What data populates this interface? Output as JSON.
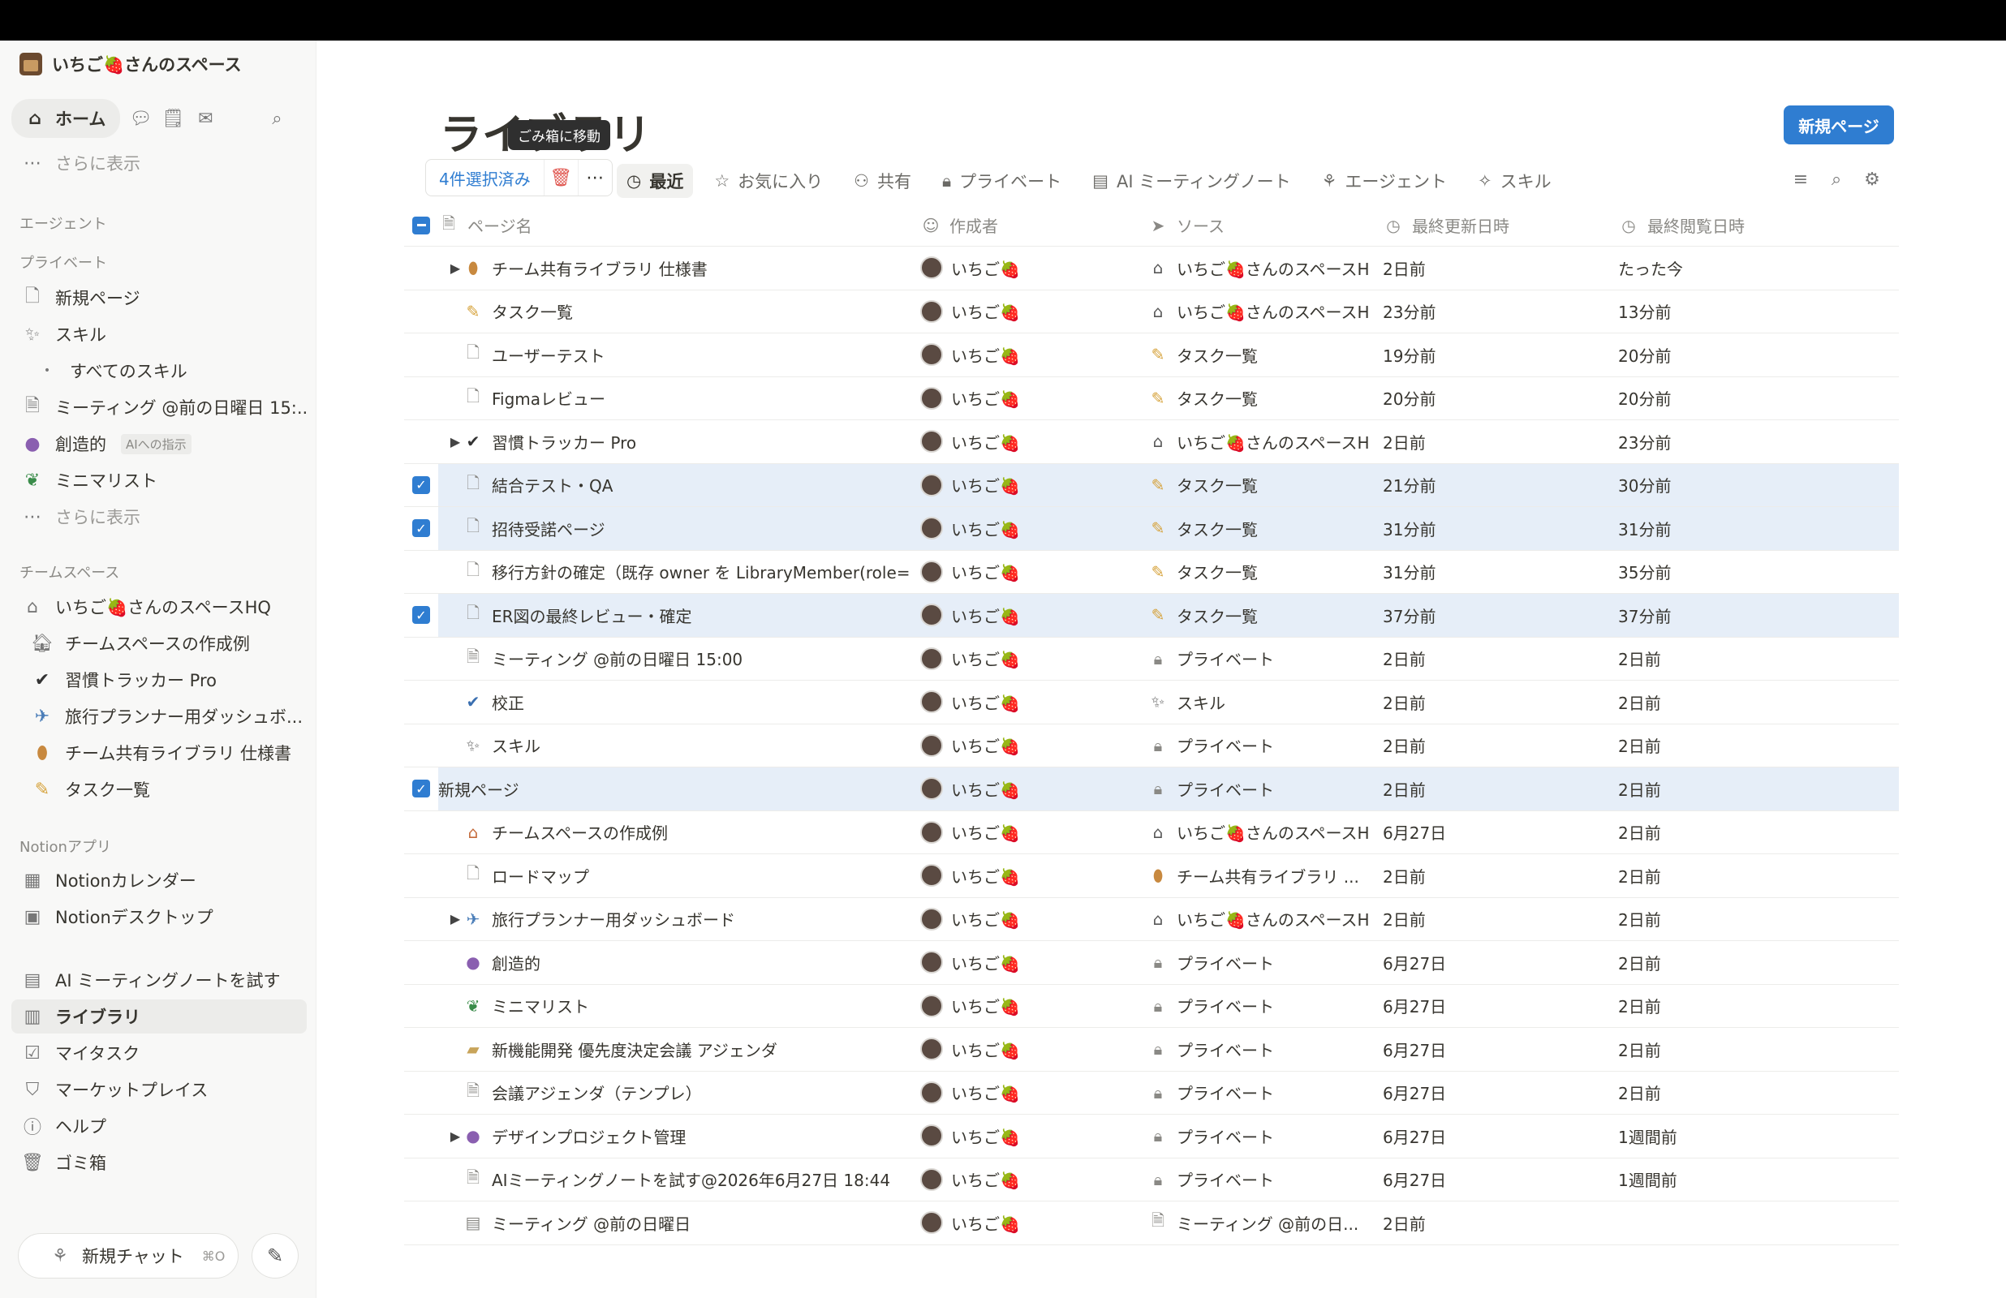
{
  "sidebar": {
    "workspace": "いちご🍓さんのスペース",
    "home_label": "ホーム",
    "show_more_1": "さらに表示",
    "agents_head": "エージェント",
    "private_head": "プライベート",
    "private_items": [
      {
        "label": "新規ページ",
        "icon": "page-icon"
      },
      {
        "label": "スキル",
        "icon": "wand-icon"
      },
      {
        "label": "すべてのスキル",
        "icon": "dot-icon"
      },
      {
        "label": "ミーティング @前の日曜日 15:...",
        "icon": "page-icon"
      },
      {
        "label": "創造的",
        "icon": "palette-icon",
        "tag": "AIへの指示"
      },
      {
        "label": "ミニマリスト",
        "icon": "leaf-icon"
      }
    ],
    "show_more_2": "さらに表示",
    "team_head": "チームスペース",
    "team_items": [
      {
        "label": "いちご🍓さんのスペースHQ",
        "icon": "home-icon"
      },
      {
        "label": "チームスペースの作成例",
        "icon": "house-icon"
      },
      {
        "label": "習慣トラッカー Pro",
        "icon": "badge-check-icon"
      },
      {
        "label": "旅行プランナー用ダッシュボ...",
        "icon": "airplane-icon"
      },
      {
        "label": "チーム共有ライブラリ 仕様書",
        "icon": "bread-icon"
      },
      {
        "label": "タスク一覧",
        "icon": "pencil-icon"
      }
    ],
    "apps_head": "Notionアプリ",
    "app_items": [
      {
        "label": "Notionカレンダー",
        "icon": "calendar-icon"
      },
      {
        "label": "Notionデスクトップ",
        "icon": "notion-icon"
      }
    ],
    "bottom_items": [
      {
        "label": "AI ミーティングノートを試す",
        "icon": "meeting-icon"
      },
      {
        "label": "ライブラリ",
        "icon": "library-icon"
      },
      {
        "label": "マイタスク",
        "icon": "checkbox-icon"
      },
      {
        "label": "マーケットプレイス",
        "icon": "marketplace-icon"
      },
      {
        "label": "ヘルプ",
        "icon": "help-icon"
      },
      {
        "label": "ゴミ箱",
        "icon": "trash-icon"
      }
    ],
    "new_chat": "新規チャット",
    "new_chat_kbd": "⌘O"
  },
  "main": {
    "title": "ライブラリ",
    "tooltip": "ごみ箱に移動",
    "new_page": "新規ページ",
    "selected": "4件選択済み",
    "tabs": [
      {
        "label": "最近",
        "icon": "clock-icon",
        "active": true
      },
      {
        "label": "お気に入り",
        "icon": "star-icon"
      },
      {
        "label": "共有",
        "icon": "people-icon"
      },
      {
        "label": "プライベート",
        "icon": "lock-icon"
      },
      {
        "label": "AI ミーティングノート",
        "icon": "meeting-icon"
      },
      {
        "label": "エージェント",
        "icon": "agent-icon"
      },
      {
        "label": "スキル",
        "icon": "skill-icon"
      }
    ],
    "columns": {
      "name": "ページ名",
      "author": "作成者",
      "source": "ソース",
      "updated": "最終更新日時",
      "viewed": "最終閲覧日時"
    },
    "rows": [
      {
        "name": "チーム共有ライブラリ 仕様書",
        "icon": "🥖",
        "exp": true,
        "author": "いちご🍓",
        "src": "いちご🍓さんのスペースH",
        "src_icon": "home",
        "upd": "2日前",
        "view": "たった今"
      },
      {
        "name": "タスク一覧",
        "icon": "✏️",
        "author": "いちご🍓",
        "src": "いちご🍓さんのスペースH",
        "src_icon": "home",
        "upd": "23分前",
        "view": "13分前"
      },
      {
        "name": "ユーザーテスト",
        "icon": "page",
        "author": "いちご🍓",
        "src": "タスク一覧",
        "src_icon": "pencil",
        "upd": "19分前",
        "view": "20分前"
      },
      {
        "name": "Figmaレビュー",
        "icon": "page",
        "author": "いちご🍓",
        "src": "タスク一覧",
        "src_icon": "pencil",
        "upd": "20分前",
        "view": "20分前"
      },
      {
        "name": "習慣トラッカー Pro",
        "icon": "badge",
        "exp": true,
        "author": "いちご🍓",
        "src": "いちご🍓さんのスペースH",
        "src_icon": "home",
        "upd": "2日前",
        "view": "23分前"
      },
      {
        "name": "結合テスト・QA",
        "icon": "page",
        "sel": true,
        "author": "いちご🍓",
        "src": "タスク一覧",
        "src_icon": "pencil",
        "upd": "21分前",
        "view": "30分前"
      },
      {
        "name": "招待受諾ページ",
        "icon": "page",
        "sel": true,
        "author": "いちご🍓",
        "src": "タスク一覧",
        "src_icon": "pencil",
        "upd": "31分前",
        "view": "31分前"
      },
      {
        "name": "移行方針の確定（既存 owner を LibraryMember(role=ow",
        "icon": "page",
        "author": "いちご🍓",
        "src": "タスク一覧",
        "src_icon": "pencil",
        "upd": "31分前",
        "view": "35分前"
      },
      {
        "name": "ER図の最終レビュー・確定",
        "icon": "page",
        "sel": true,
        "author": "いちご🍓",
        "src": "タスク一覧",
        "src_icon": "pencil",
        "upd": "37分前",
        "view": "37分前"
      },
      {
        "name": "ミーティング @前の日曜日 15:00",
        "icon": "doc",
        "author": "いちご🍓",
        "src": "プライベート",
        "src_icon": "lock",
        "upd": "2日前",
        "view": "2日前"
      },
      {
        "name": "校正",
        "icon": "check-circle",
        "author": "いちご🍓",
        "src": "スキル",
        "src_icon": "wand",
        "upd": "2日前",
        "view": "2日前"
      },
      {
        "name": "スキル",
        "icon": "wand",
        "author": "いちご🍓",
        "src": "プライベート",
        "src_icon": "lock",
        "upd": "2日前",
        "view": "2日前"
      },
      {
        "name": "新規ページ",
        "icon": "",
        "sel": true,
        "author": "いちご🍓",
        "src": "プライベート",
        "src_icon": "lock",
        "upd": "2日前",
        "view": "2日前"
      },
      {
        "name": "チームスペースの作成例",
        "icon": "🏠",
        "author": "いちご🍓",
        "src": "いちご🍓さんのスペースH",
        "src_icon": "home",
        "upd": "6月27日",
        "view": "2日前"
      },
      {
        "name": "ロードマップ",
        "icon": "page",
        "author": "いちご🍓",
        "src": "チーム共有ライブラリ ...",
        "src_icon": "bread",
        "upd": "2日前",
        "view": "2日前"
      },
      {
        "name": "旅行プランナー用ダッシュボード",
        "icon": "✈️",
        "exp": true,
        "author": "いちご🍓",
        "src": "いちご🍓さんのスペースH",
        "src_icon": "home",
        "upd": "2日前",
        "view": "2日前"
      },
      {
        "name": "創造的",
        "icon": "🎨",
        "author": "いちご🍓",
        "src": "プライベート",
        "src_icon": "lock",
        "upd": "6月27日",
        "view": "2日前"
      },
      {
        "name": "ミニマリスト",
        "icon": "🍃",
        "author": "いちご🍓",
        "src": "プライベート",
        "src_icon": "lock",
        "upd": "6月27日",
        "view": "2日前"
      },
      {
        "name": "新機能開発 優先度決定会議 アジェンダ",
        "icon": "🗂️",
        "author": "いちご🍓",
        "src": "プライベート",
        "src_icon": "lock",
        "upd": "6月27日",
        "view": "2日前"
      },
      {
        "name": "会議アジェンダ（テンプレ）",
        "icon": "doc",
        "author": "いちご🍓",
        "src": "プライベート",
        "src_icon": "lock",
        "upd": "6月27日",
        "view": "2日前"
      },
      {
        "name": "デザインプロジェクト管理",
        "icon": "🎨",
        "exp": true,
        "author": "いちご🍓",
        "src": "プライベート",
        "src_icon": "lock",
        "upd": "6月27日",
        "view": "1週間前"
      },
      {
        "name": "AIミーティングノートを試す@2026年6月27日 18:44",
        "icon": "doc",
        "author": "いちご🍓",
        "src": "プライベート",
        "src_icon": "lock",
        "upd": "6月27日",
        "view": "1週間前"
      },
      {
        "name": "ミーティング @前の日曜日",
        "icon": "meeting",
        "author": "いちご🍓",
        "src": "ミーティング @前の日...",
        "src_icon": "doc",
        "upd": "2日前",
        "view": ""
      }
    ]
  }
}
